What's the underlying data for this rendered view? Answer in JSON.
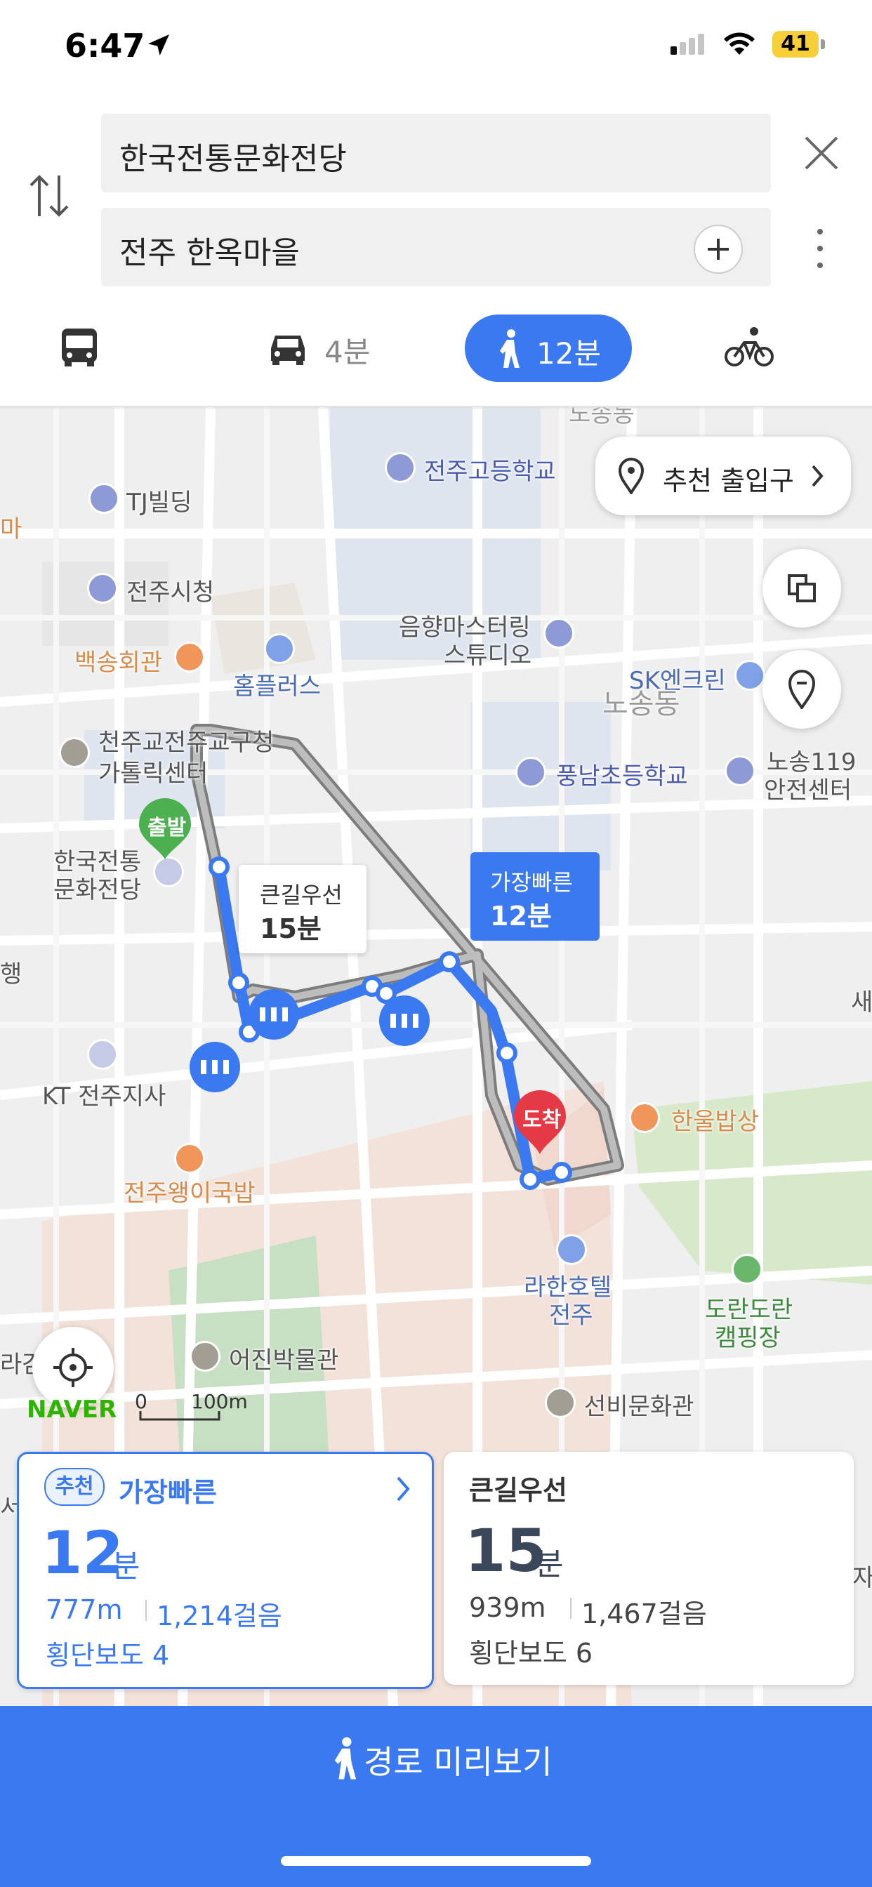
{
  "status_bar": {
    "time": "6:47",
    "battery": "41"
  },
  "search": {
    "origin": "한국전통문화전당",
    "destination": "전주 한옥마을"
  },
  "modes": {
    "car_time": "4분",
    "walk_time": "12분",
    "selected": "walk"
  },
  "map": {
    "labels": {
      "top_cut": "노송동",
      "school_high": "전주고등학교",
      "tj": "TJ빌딩",
      "city_hall": "전주시청",
      "music1": "음향마스터링",
      "music2": "스튜디오",
      "baeksong": "백송회관",
      "homeplus": "홈플러스",
      "sk": "SK엔크린",
      "nosong": "노송동",
      "catholic1": "천주교전주교구청",
      "catholic2": "가톨릭센터",
      "pungnam": "풍남초등학교",
      "n119a": "노송119",
      "n119b": "안전센터",
      "origin_lbl1": "한국전통",
      "origin_lbl2": "문화전당",
      "kt": "KT 전주지사",
      "hanul": "한울밥상",
      "wangi": "전주왱이국밥",
      "lahan1": "라한호텔",
      "lahan2": "전주",
      "doran1": "도란도란",
      "doran2": "캠핑장",
      "eojin": "어진박물관",
      "seonbi": "선비문화관",
      "left_cut1": "마",
      "left_cut2": "행",
      "left_cut3": "라감",
      "left_cut4": "서",
      "right_cut1": "새",
      "right_cut2": "자"
    },
    "chip_entrance": "추천 출입구",
    "start_pin": "출발",
    "end_pin": "도착",
    "callout_main_title": "큰길우선",
    "callout_main_time": "15분",
    "callout_fast_title": "가장빠른",
    "callout_fast_time": "12분",
    "naver": "NAVER",
    "scale_zero": "0",
    "scale_dist": "100m"
  },
  "routes": [
    {
      "badge": "추천",
      "title": "가장빠른",
      "minutes": "12",
      "unit": "분",
      "distance": "777m",
      "steps": "1,214걸음",
      "crosswalks": "횡단보도 4"
    },
    {
      "title": "큰길우선",
      "minutes": "15",
      "unit": "분",
      "distance": "939m",
      "steps": "1,467걸음",
      "crosswalks": "횡단보도 6"
    }
  ],
  "preview_button": "경로 미리보기",
  "colors": {
    "accent": "#3b79f0",
    "pin_start": "#4caf50",
    "pin_end": "#e53946"
  }
}
